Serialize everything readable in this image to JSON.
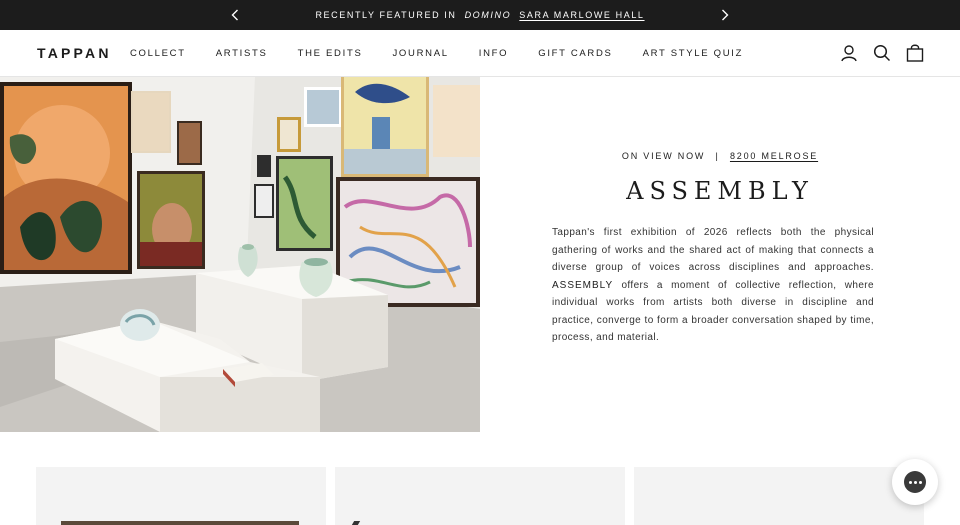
{
  "announcement": {
    "prefix": "Recently featured in",
    "publication": "Domino",
    "link_text": "Sara Marlowe Hall"
  },
  "header": {
    "logo": "TAPPAN",
    "nav": [
      "Collect",
      "Artists",
      "The Edits",
      "Journal",
      "Info",
      "Gift Cards",
      "Art Style Quiz"
    ]
  },
  "hero": {
    "eyebrow_prefix": "On View Now",
    "separator": "|",
    "location": "8200 Melrose",
    "title": "ASSEMBLY",
    "body_before": "Tappan's first exhibition of 2026 reflects both the physical gathering of works and the shared act of making that connects a diverse group of voices across disciplines and approaches.",
    "body_emphasis": "ASSEMBLY",
    "body_after": "offers a moment of collective reflection, where individual works from artists both diverse in discipline and practice, converge to form a broader conversation shaped by time, process, and material."
  },
  "colors": {
    "announcement_bg": "#1c1c1c",
    "text": "#1c1c1c",
    "card_bg": "#f3f3f3"
  },
  "icons": [
    "chevron-left-icon",
    "chevron-right-icon",
    "account-icon",
    "search-icon",
    "cart-icon",
    "chat-icon"
  ]
}
